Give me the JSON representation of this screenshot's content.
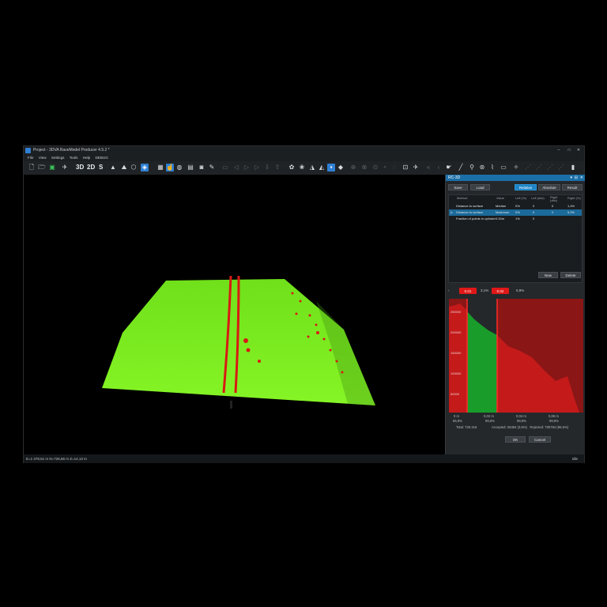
{
  "window": {
    "title": "Project - 3DVA RaveModel Producer 4.5.2 *",
    "controls": [
      "–",
      "□",
      "✕"
    ]
  },
  "menu": [
    "File",
    "View",
    "Settings",
    "Tools",
    "Help",
    "DEBUG"
  ],
  "toolbar": {
    "view_3d": "3D",
    "view_2d": "2D",
    "view_s": "S"
  },
  "statusbar": {
    "coords": "E=1 378,51 m N=726,66 m Z=14,13 m",
    "state": "Idle"
  },
  "panel": {
    "title": "RC-3D",
    "header_icons": [
      "▾",
      "⊟",
      "✕"
    ],
    "save_label": "Save",
    "load_label": "Load",
    "mode_relative": "Relative",
    "mode_absolute": "Absolute",
    "result_label": "Result",
    "columns": [
      "Method",
      "Value",
      "Left (%)",
      "Left (dist)",
      "Right (dist)",
      "Right (%)"
    ],
    "rows": [
      {
        "method": "Distance to surface",
        "value": "Median",
        "left_pct": "0%",
        "left_dist": "0",
        "right_dist": "0",
        "right_pct": "1,4%"
      },
      {
        "method": "Distance to surface",
        "value": "Maximum",
        "left_pct": "0%",
        "left_dist": "0",
        "right_dist": "0",
        "right_pct": "5,9%"
      },
      {
        "method": "Fraction of points in cylinder",
        "value": "0.00m",
        "left_pct": "1%",
        "left_dist": "0",
        "right_dist": "",
        "right_pct": ""
      }
    ],
    "new_label": "New",
    "delete_label": "Delete",
    "thresholds": {
      "left_value": "0.01",
      "left_pct": "3,1%",
      "right_value": "0.02",
      "right_pct": "0,9%"
    },
    "histogram": {
      "y_ticks": [
        "250000",
        "200000",
        "150000",
        "100000",
        "50000"
      ],
      "x_ticks": [
        {
          "value": "0 m",
          "pct": "55,9%"
        },
        {
          "value": "0,02 m",
          "pct": "99,6%"
        },
        {
          "value": "0,04 m",
          "pct": "99,9%"
        },
        {
          "value": "0,06 m",
          "pct": "99,9%"
        }
      ],
      "total": "Total: 726 216",
      "summary": "Accepted: 25454 (3,5%)   Rejected: 700764 (96,5%)"
    },
    "ok_label": "OK",
    "cancel_label": "Cancel"
  },
  "colors": {
    "cloud_green": "#7ff01f",
    "highlight_red": "#e01818",
    "accent_blue": "#1f84c5"
  }
}
